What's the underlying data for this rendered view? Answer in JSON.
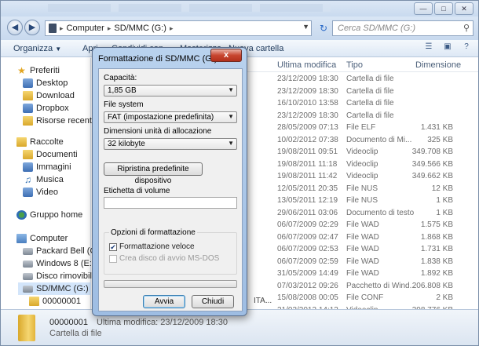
{
  "address": {
    "path": [
      "Computer",
      "SD/MMC (G:)"
    ],
    "search_placeholder": "Cerca SD/MMC (G:)"
  },
  "toolbar": {
    "organize": "Organizza",
    "open_fragment": "Apri",
    "share": "Condividi con",
    "burn": "Masterizza",
    "new_folder": "Nuova cartella"
  },
  "nav": {
    "favorites_header": "Preferiti",
    "favorites": [
      "Desktop",
      "Download",
      "Dropbox",
      "Risorse recenti"
    ],
    "libraries_header": "Raccolte",
    "libraries": [
      "Documenti",
      "Immagini",
      "Musica",
      "Video"
    ],
    "homegroup": "Gruppo home",
    "computer_header": "Computer",
    "drives": [
      "Packard Bell (C:)",
      "Windows 8 (E:)",
      "Disco rimovibile",
      "SD/MMC (G:)"
    ],
    "subfolders": [
      "00000001",
      "...."
    ]
  },
  "columns": {
    "date": "Ultima modifica",
    "type": "Tipo",
    "size": "Dimensione"
  },
  "rows": [
    {
      "date": "23/12/2009 18:30",
      "type": "Cartella di file",
      "size": ""
    },
    {
      "date": "23/12/2009 18:30",
      "type": "Cartella di file",
      "size": ""
    },
    {
      "date": "16/10/2010 13:58",
      "type": "Cartella di file",
      "size": ""
    },
    {
      "date": "23/12/2009 18:30",
      "type": "Cartella di file",
      "size": ""
    },
    {
      "date": "28/05/2009 07:13",
      "type": "File ELF",
      "size": "1.431 KB"
    },
    {
      "date": "10/02/2012 07:38",
      "type": "Documento di Mi...",
      "size": "325 KB"
    },
    {
      "date": "19/08/2011 09:51",
      "type": "Videoclip",
      "size": "349.708 KB"
    },
    {
      "date": "19/08/2011 11:18",
      "type": "Videoclip",
      "size": "349.566 KB"
    },
    {
      "date": "19/08/2011 11:42",
      "type": "Videoclip",
      "size": "349.662 KB"
    },
    {
      "date": "12/05/2011 20:35",
      "type": "File NUS",
      "size": "12 KB"
    },
    {
      "date": "13/05/2011 12:19",
      "type": "File NUS",
      "size": "1 KB"
    },
    {
      "date": "29/06/2011 03:06",
      "type": "Documento di testo",
      "size": "1 KB"
    },
    {
      "date": "06/07/2009 02:29",
      "type": "File WAD",
      "size": "1.575 KB"
    },
    {
      "date": "06/07/2009 02:47",
      "type": "File WAD",
      "size": "1.868 KB"
    },
    {
      "date": "06/07/2009 02:53",
      "type": "File WAD",
      "size": "1.731 KB"
    },
    {
      "date": "06/07/2009 02:59",
      "type": "File WAD",
      "size": "1.838 KB"
    },
    {
      "date": "31/05/2009 14:49",
      "type": "File WAD",
      "size": "1.892 KB"
    },
    {
      "date": "07/03/2012 09:26",
      "type": "Pacchetto di Wind...",
      "size": "206.808 KB"
    },
    {
      "date": "15/08/2008 00:05",
      "type": "File CONF",
      "size": "2 KB"
    },
    {
      "date": "21/03/2012 14:12",
      "type": "Videoclip",
      "size": "398.776 KB"
    }
  ],
  "row_fragment": "ITA...",
  "details": {
    "name": "00000001",
    "type": "Cartella di file",
    "modified": "Ultima modifica: 23/12/2009 18:30"
  },
  "dialog": {
    "title": "Formattazione di SD/MMC (G:)",
    "close_glyph": "x",
    "capacity_label": "Capacità:",
    "capacity_value": "1,85 GB",
    "fs_label": "File system",
    "fs_value": "FAT (impostazione predefinita)",
    "alloc_label": "Dimensioni unità di allocazione",
    "alloc_value": "32 kilobyte",
    "restore_button": "Ripristina predefinite dispositivo",
    "volume_label": "Etichetta di volume",
    "volume_value": "",
    "options_title": "Opzioni di formattazione",
    "quick_format": "Formattazione veloce",
    "quick_format_checked": true,
    "msdos_disk": "Crea disco di avvio MS-DOS",
    "msdos_checked": false,
    "progress_fraction": 0,
    "start_button": "Avvia",
    "close_button": "Chiudi"
  }
}
